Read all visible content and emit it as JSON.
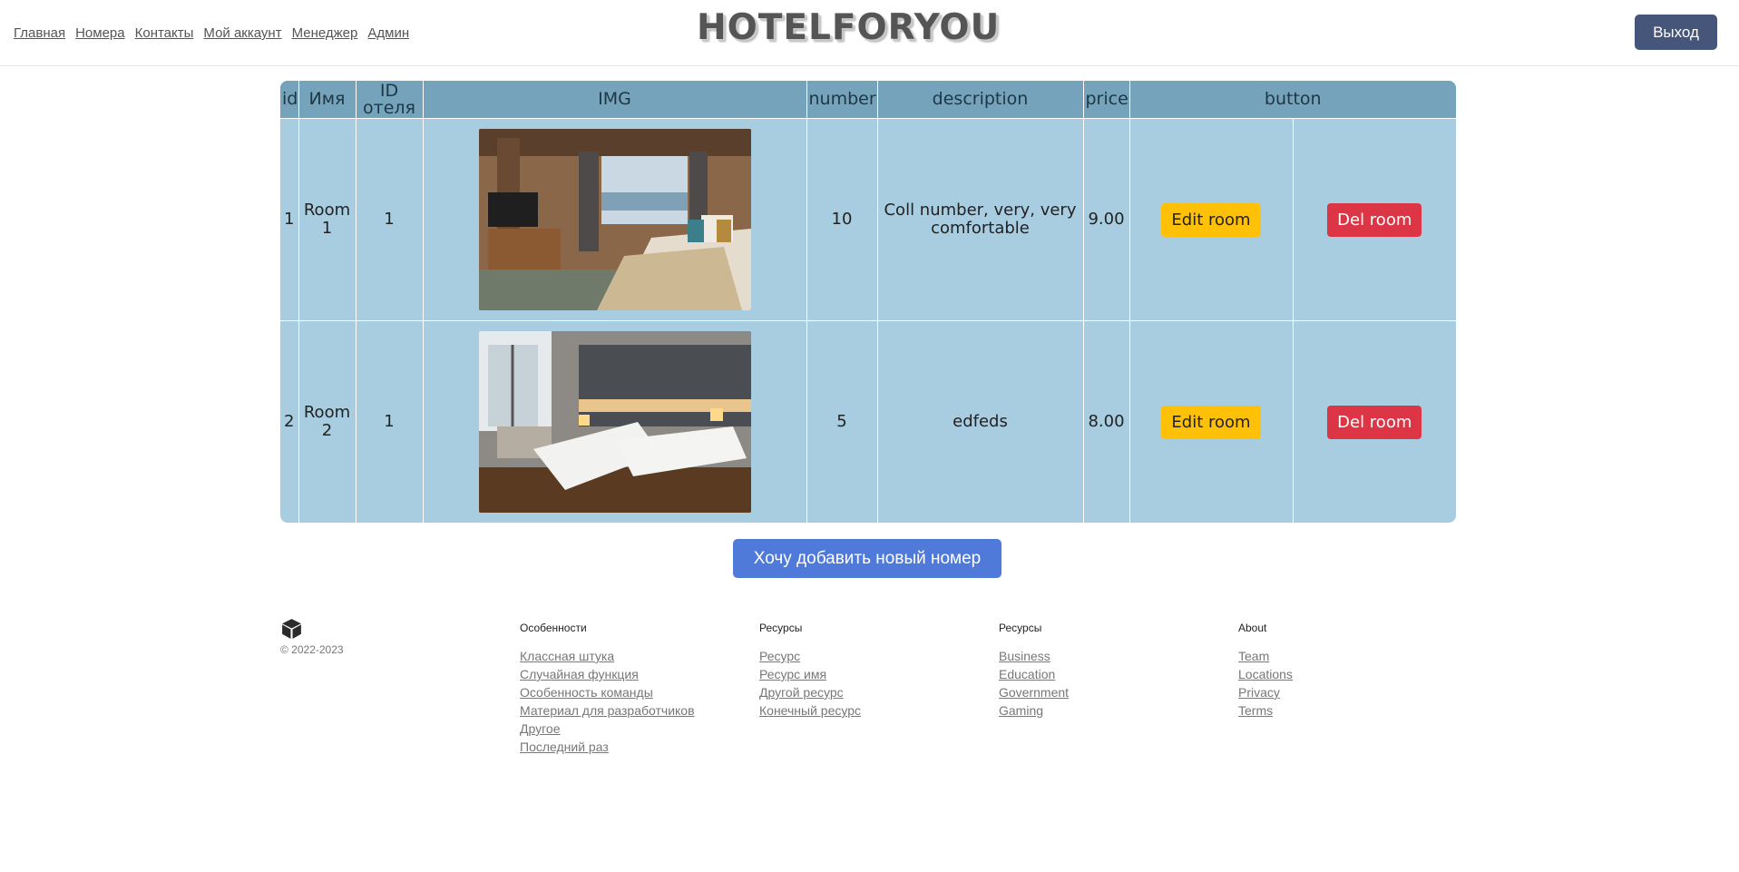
{
  "nav": {
    "items": [
      "Главная",
      "Номера",
      "Контакты",
      "Мой аккаунт",
      "Менеджер",
      "Админ"
    ]
  },
  "header": {
    "logo": "HOTELFORYOU",
    "logout_label": "Выход"
  },
  "table": {
    "columns": [
      "id",
      "Имя",
      "ID отеля",
      "IMG",
      "number",
      "description",
      "price",
      "button"
    ],
    "rows": [
      {
        "id": "1",
        "name": "Room 1",
        "hotel_id": "1",
        "number": "10",
        "description": "Coll number, very, very comfortable",
        "price": "9.00",
        "edit_label": "Edit room",
        "del_label": "Del room"
      },
      {
        "id": "2",
        "name": "Room 2",
        "hotel_id": "1",
        "number": "5",
        "description": "edfeds",
        "price": "8.00",
        "edit_label": "Edit room",
        "del_label": "Del room"
      }
    ]
  },
  "add_button_label": "Хочу добавить новый номер",
  "footer": {
    "copyright": "© 2022-2023",
    "columns": [
      {
        "title": "Особенности",
        "links": [
          "Классная штука",
          "Случайная функция",
          "Особенность команды",
          "Материал для разработчиков",
          "Другое",
          "Последний раз"
        ]
      },
      {
        "title": "Ресурсы",
        "links": [
          "Ресурс",
          "Ресурс имя",
          "Другой ресурс",
          "Конечный ресурс"
        ]
      },
      {
        "title": "Ресурсы",
        "links": [
          "Business",
          "Education",
          "Government",
          "Gaming"
        ]
      },
      {
        "title": "About",
        "links": [
          "Team",
          "Locations",
          "Privacy",
          "Terms"
        ]
      }
    ]
  },
  "colors": {
    "logout_bg": "#45567a",
    "table_bg": "#a9cde0",
    "table_header_bg": "#74a3bb",
    "edit_button": "#ffc107",
    "delete_button": "#dc3545",
    "add_button": "#4f7ad9"
  },
  "icons": {
    "footer_brand": "box-icon"
  }
}
